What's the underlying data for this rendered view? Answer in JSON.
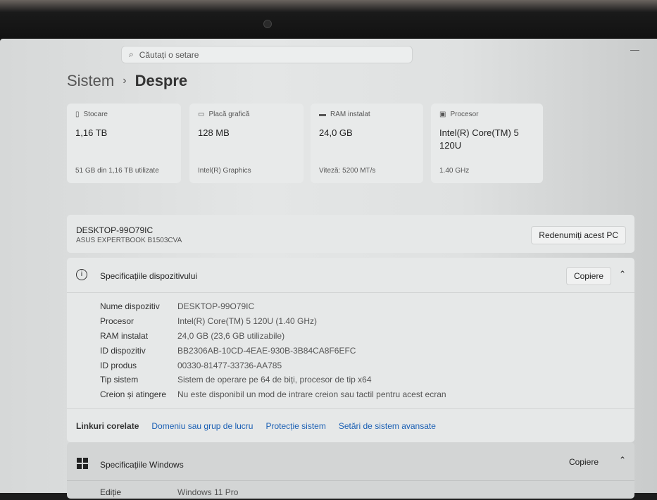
{
  "search": {
    "placeholder": "Căutați o setare"
  },
  "breadcrumb": {
    "parent": "Sistem",
    "current": "Despre"
  },
  "cards": [
    {
      "label": "Stocare",
      "value": "1,16 TB",
      "footer": "51 GB din 1,16 TB utilizate",
      "icon": "storage-icon"
    },
    {
      "label": "Placă grafică",
      "value": "128 MB",
      "footer": "Intel(R) Graphics",
      "icon": "gpu-icon"
    },
    {
      "label": "RAM instalat",
      "value": "24,0 GB",
      "footer": "Viteză: 5200 MT/s",
      "icon": "ram-icon"
    },
    {
      "label": "Procesor",
      "value": "Intel(R) Core(TM) 5 120U",
      "footer": "1.40 GHz",
      "icon": "cpu-icon"
    }
  ],
  "pc": {
    "name": "DESKTOP-99O79IC",
    "model": "ASUS EXPERTBOOK B1503CVA",
    "rename_label": "Redenumiți acest PC"
  },
  "device_specs": {
    "title": "Specificațiile dispozitivului",
    "copy_label": "Copiere",
    "rows": [
      {
        "k": "Nume dispozitiv",
        "v": "DESKTOP-99O79IC"
      },
      {
        "k": "Procesor",
        "v": "Intel(R) Core(TM) 5 120U (1.40 GHz)"
      },
      {
        "k": "RAM instalat",
        "v": "24,0 GB (23,6 GB utilizabile)"
      },
      {
        "k": "ID dispozitiv",
        "v": "BB2306AB-10CD-4EAE-930B-3B84CA8F6EFC"
      },
      {
        "k": "ID produs",
        "v": "00330-81477-33736-AA785"
      },
      {
        "k": "Tip sistem",
        "v": "Sistem de operare pe 64 de biți, procesor de tip x64"
      },
      {
        "k": "Creion și atingere",
        "v": "Nu este disponibil un mod de intrare creion sau tactil pentru acest ecran"
      }
    ]
  },
  "related": {
    "label": "Linkuri corelate",
    "links": [
      "Domeniu sau grup de lucru",
      "Protecție sistem",
      "Setări de sistem avansate"
    ]
  },
  "windows_specs": {
    "title": "Specificațiile Windows",
    "copy_label": "Copiere",
    "rows": [
      {
        "k": "Ediție",
        "v": "Windows 11 Pro"
      }
    ]
  }
}
